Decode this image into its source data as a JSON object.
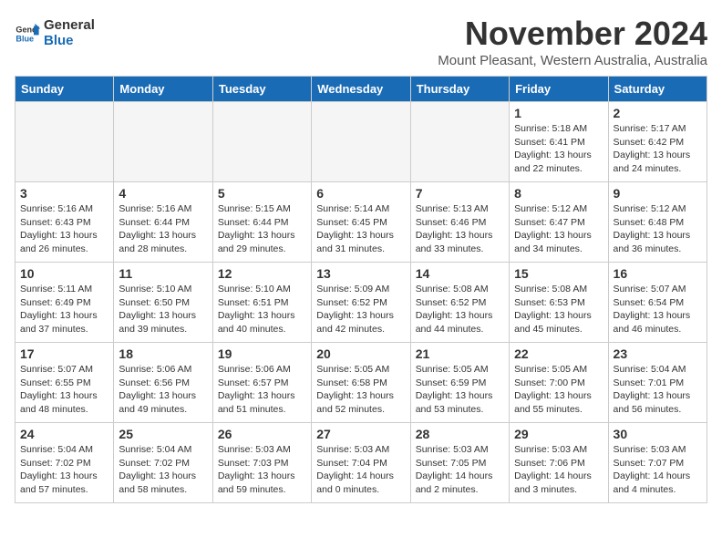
{
  "logo": {
    "line1": "General",
    "line2": "Blue"
  },
  "title": "November 2024",
  "subtitle": "Mount Pleasant, Western Australia, Australia",
  "weekdays": [
    "Sunday",
    "Monday",
    "Tuesday",
    "Wednesday",
    "Thursday",
    "Friday",
    "Saturday"
  ],
  "weeks": [
    [
      {
        "day": "",
        "info": ""
      },
      {
        "day": "",
        "info": ""
      },
      {
        "day": "",
        "info": ""
      },
      {
        "day": "",
        "info": ""
      },
      {
        "day": "",
        "info": ""
      },
      {
        "day": "1",
        "info": "Sunrise: 5:18 AM\nSunset: 6:41 PM\nDaylight: 13 hours\nand 22 minutes."
      },
      {
        "day": "2",
        "info": "Sunrise: 5:17 AM\nSunset: 6:42 PM\nDaylight: 13 hours\nand 24 minutes."
      }
    ],
    [
      {
        "day": "3",
        "info": "Sunrise: 5:16 AM\nSunset: 6:43 PM\nDaylight: 13 hours\nand 26 minutes."
      },
      {
        "day": "4",
        "info": "Sunrise: 5:16 AM\nSunset: 6:44 PM\nDaylight: 13 hours\nand 28 minutes."
      },
      {
        "day": "5",
        "info": "Sunrise: 5:15 AM\nSunset: 6:44 PM\nDaylight: 13 hours\nand 29 minutes."
      },
      {
        "day": "6",
        "info": "Sunrise: 5:14 AM\nSunset: 6:45 PM\nDaylight: 13 hours\nand 31 minutes."
      },
      {
        "day": "7",
        "info": "Sunrise: 5:13 AM\nSunset: 6:46 PM\nDaylight: 13 hours\nand 33 minutes."
      },
      {
        "day": "8",
        "info": "Sunrise: 5:12 AM\nSunset: 6:47 PM\nDaylight: 13 hours\nand 34 minutes."
      },
      {
        "day": "9",
        "info": "Sunrise: 5:12 AM\nSunset: 6:48 PM\nDaylight: 13 hours\nand 36 minutes."
      }
    ],
    [
      {
        "day": "10",
        "info": "Sunrise: 5:11 AM\nSunset: 6:49 PM\nDaylight: 13 hours\nand 37 minutes."
      },
      {
        "day": "11",
        "info": "Sunrise: 5:10 AM\nSunset: 6:50 PM\nDaylight: 13 hours\nand 39 minutes."
      },
      {
        "day": "12",
        "info": "Sunrise: 5:10 AM\nSunset: 6:51 PM\nDaylight: 13 hours\nand 40 minutes."
      },
      {
        "day": "13",
        "info": "Sunrise: 5:09 AM\nSunset: 6:52 PM\nDaylight: 13 hours\nand 42 minutes."
      },
      {
        "day": "14",
        "info": "Sunrise: 5:08 AM\nSunset: 6:52 PM\nDaylight: 13 hours\nand 44 minutes."
      },
      {
        "day": "15",
        "info": "Sunrise: 5:08 AM\nSunset: 6:53 PM\nDaylight: 13 hours\nand 45 minutes."
      },
      {
        "day": "16",
        "info": "Sunrise: 5:07 AM\nSunset: 6:54 PM\nDaylight: 13 hours\nand 46 minutes."
      }
    ],
    [
      {
        "day": "17",
        "info": "Sunrise: 5:07 AM\nSunset: 6:55 PM\nDaylight: 13 hours\nand 48 minutes."
      },
      {
        "day": "18",
        "info": "Sunrise: 5:06 AM\nSunset: 6:56 PM\nDaylight: 13 hours\nand 49 minutes."
      },
      {
        "day": "19",
        "info": "Sunrise: 5:06 AM\nSunset: 6:57 PM\nDaylight: 13 hours\nand 51 minutes."
      },
      {
        "day": "20",
        "info": "Sunrise: 5:05 AM\nSunset: 6:58 PM\nDaylight: 13 hours\nand 52 minutes."
      },
      {
        "day": "21",
        "info": "Sunrise: 5:05 AM\nSunset: 6:59 PM\nDaylight: 13 hours\nand 53 minutes."
      },
      {
        "day": "22",
        "info": "Sunrise: 5:05 AM\nSunset: 7:00 PM\nDaylight: 13 hours\nand 55 minutes."
      },
      {
        "day": "23",
        "info": "Sunrise: 5:04 AM\nSunset: 7:01 PM\nDaylight: 13 hours\nand 56 minutes."
      }
    ],
    [
      {
        "day": "24",
        "info": "Sunrise: 5:04 AM\nSunset: 7:02 PM\nDaylight: 13 hours\nand 57 minutes."
      },
      {
        "day": "25",
        "info": "Sunrise: 5:04 AM\nSunset: 7:02 PM\nDaylight: 13 hours\nand 58 minutes."
      },
      {
        "day": "26",
        "info": "Sunrise: 5:03 AM\nSunset: 7:03 PM\nDaylight: 13 hours\nand 59 minutes."
      },
      {
        "day": "27",
        "info": "Sunrise: 5:03 AM\nSunset: 7:04 PM\nDaylight: 14 hours\nand 0 minutes."
      },
      {
        "day": "28",
        "info": "Sunrise: 5:03 AM\nSunset: 7:05 PM\nDaylight: 14 hours\nand 2 minutes."
      },
      {
        "day": "29",
        "info": "Sunrise: 5:03 AM\nSunset: 7:06 PM\nDaylight: 14 hours\nand 3 minutes."
      },
      {
        "day": "30",
        "info": "Sunrise: 5:03 AM\nSunset: 7:07 PM\nDaylight: 14 hours\nand 4 minutes."
      }
    ]
  ]
}
